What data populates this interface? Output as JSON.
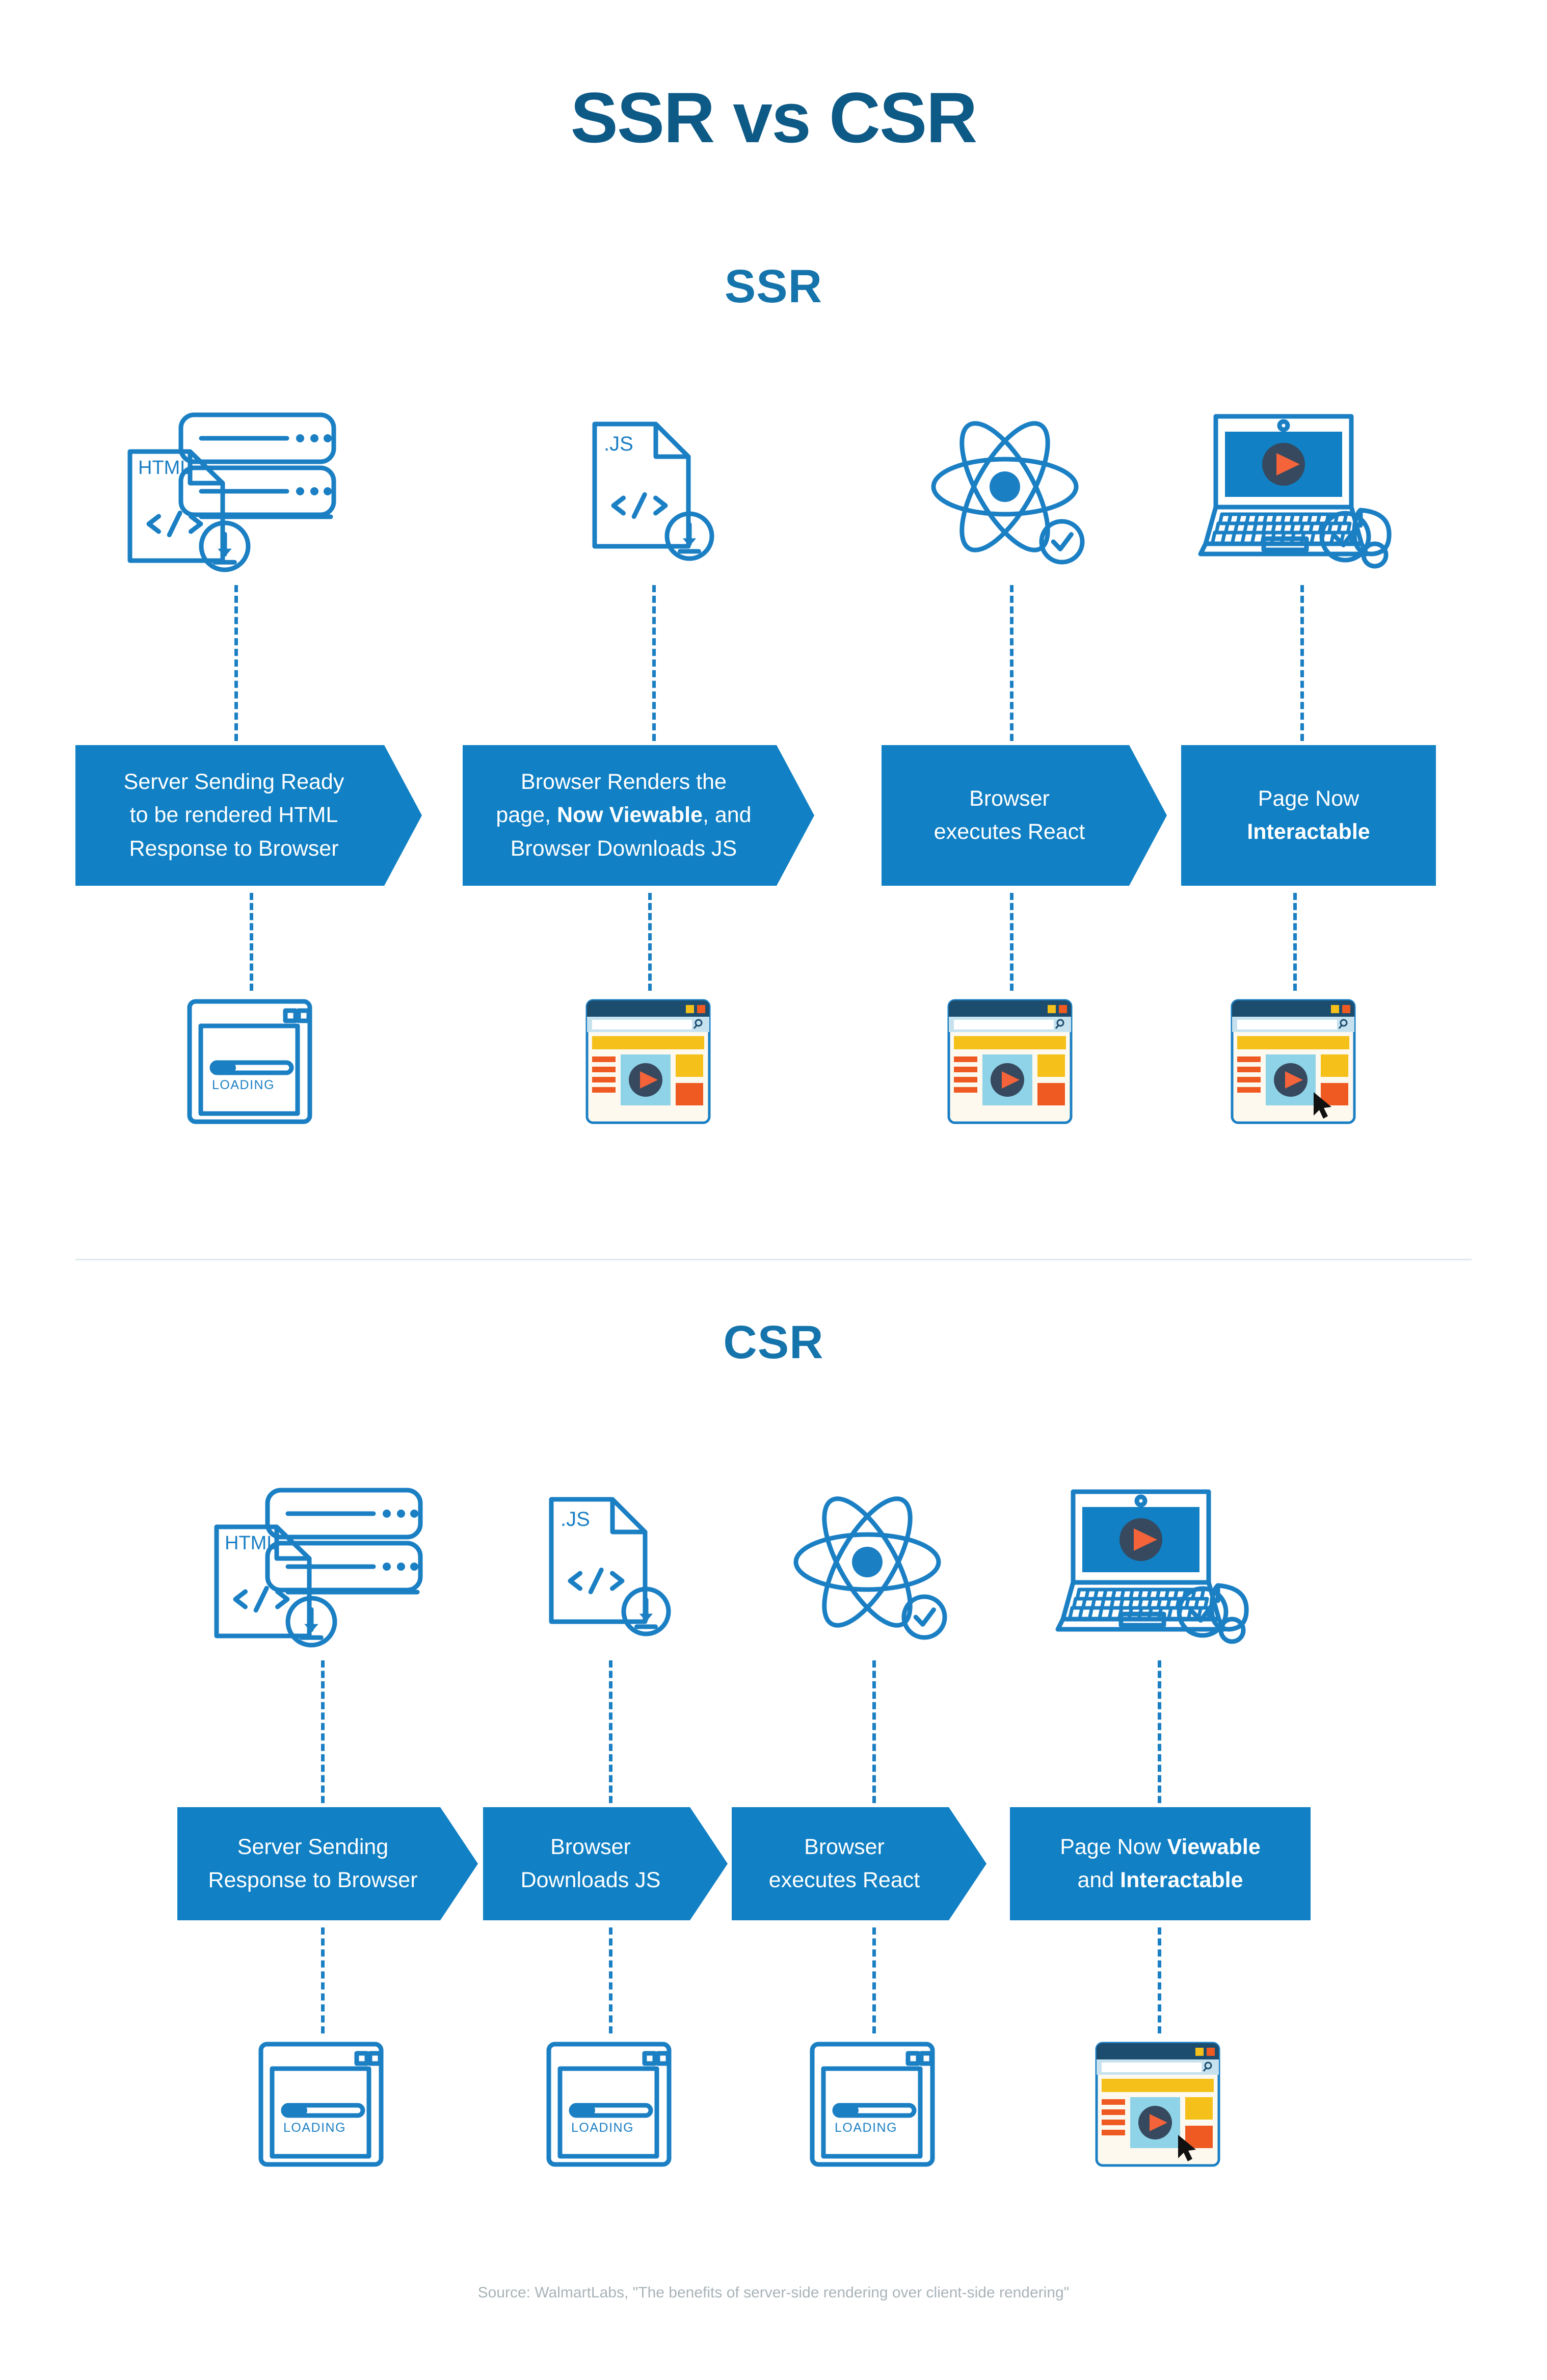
{
  "title": "SSR vs CSR",
  "colors": {
    "title_navy": "#0e5a87",
    "heading_blue": "#1574ab",
    "banner_blue": "#1180c4",
    "line_blue": "#1b7fc4",
    "mock_titlebar": "#1d4d6e",
    "mock_yellow": "#f5c019",
    "mock_orange": "#ef5a22",
    "mock_lightblue": "#8fd3e8",
    "mock_dark": "#36495e",
    "mock_play": "#f4633a",
    "mock_body": "#fdf9ee",
    "divider_grey": "#dde9ee",
    "source_grey": "#a9b3b8"
  },
  "sections": [
    {
      "id": "ssr",
      "heading": "SSR",
      "stages": [
        {
          "icon": "html-server-download-icon",
          "banner": {
            "shape": "pointed",
            "lines": [
              [
                {
                  "t": "Server Sending Ready",
                  "b": false
                }
              ],
              [
                {
                  "t": "to be rendered HTML",
                  "b": false
                }
              ],
              [
                {
                  "t": "Response to Browser",
                  "b": false
                }
              ]
            ]
          },
          "mock": {
            "type": "loading",
            "label": "LOADING",
            "progress": 30
          }
        },
        {
          "icon": "js-file-download-icon",
          "banner": {
            "shape": "pointed",
            "lines": [
              [
                {
                  "t": "Browser Renders the",
                  "b": false
                }
              ],
              [
                {
                  "t": "page, ",
                  "b": false
                },
                {
                  "t": "Now Viewable",
                  "b": true
                },
                {
                  "t": ", and",
                  "b": false
                }
              ],
              [
                {
                  "t": "Browser Downloads JS",
                  "b": false
                }
              ]
            ]
          },
          "mock": {
            "type": "page",
            "cursor": false
          }
        },
        {
          "icon": "react-atom-check-icon",
          "banner": {
            "shape": "pointed",
            "lines": [
              [
                {
                  "t": "Browser",
                  "b": false
                }
              ],
              [
                {
                  "t": "executes React",
                  "b": false
                }
              ]
            ]
          },
          "mock": {
            "type": "page",
            "cursor": false
          }
        },
        {
          "icon": "laptop-mouse-check-icon",
          "banner": {
            "shape": "rect",
            "lines": [
              [
                {
                  "t": "Page Now",
                  "b": false
                }
              ],
              [
                {
                  "t": "Interactable",
                  "b": true
                }
              ]
            ]
          },
          "mock": {
            "type": "page",
            "cursor": true
          }
        }
      ]
    },
    {
      "id": "csr",
      "heading": "CSR",
      "stages": [
        {
          "icon": "html-server-download-icon",
          "banner": {
            "shape": "pointed",
            "lines": [
              [
                {
                  "t": "Server Sending",
                  "b": false
                }
              ],
              [
                {
                  "t": "Response to Browser",
                  "b": false
                }
              ]
            ]
          },
          "mock": {
            "type": "loading",
            "label": "LOADING",
            "progress": 30
          }
        },
        {
          "icon": "js-file-download-icon",
          "banner": {
            "shape": "pointed",
            "lines": [
              [
                {
                  "t": "Browser",
                  "b": false
                }
              ],
              [
                {
                  "t": "Downloads JS",
                  "b": false
                }
              ]
            ]
          },
          "mock": {
            "type": "loading",
            "label": "LOADING",
            "progress": 30
          }
        },
        {
          "icon": "react-atom-check-icon",
          "banner": {
            "shape": "pointed",
            "lines": [
              [
                {
                  "t": "Browser",
                  "b": false
                }
              ],
              [
                {
                  "t": "executes React",
                  "b": false
                }
              ]
            ]
          },
          "mock": {
            "type": "loading",
            "label": "LOADING",
            "progress": 30
          }
        },
        {
          "icon": "laptop-mouse-check-icon",
          "banner": {
            "shape": "rect",
            "lines": [
              [
                {
                  "t": "Page Now ",
                  "b": false
                },
                {
                  "t": "Viewable",
                  "b": true
                }
              ],
              [
                {
                  "t": "and ",
                  "b": false
                },
                {
                  "t": "Interactable",
                  "b": true
                }
              ]
            ]
          },
          "mock": {
            "type": "page",
            "cursor": true
          }
        }
      ]
    }
  ],
  "icon_labels": {
    "html_file": "HTML",
    "js_file": ".JS",
    "code_tag": "</>"
  },
  "footer": {
    "source": "Source: WalmartLabs, \"The benefits of server-side rendering over client-side rendering\""
  }
}
